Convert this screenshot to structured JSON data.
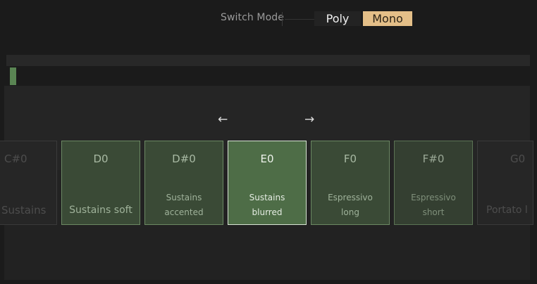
{
  "header": {
    "switch_mode_label": "Switch Mode",
    "options": [
      {
        "label": "Poly",
        "selected": false
      },
      {
        "label": "Mono",
        "selected": true
      }
    ]
  },
  "navigation": {
    "prev_arrow": "←",
    "next_arrow": "→"
  },
  "articulations": [
    {
      "note": "C#0",
      "desc": "Sustains",
      "state": "faint"
    },
    {
      "note": "D0",
      "desc": "Sustains soft",
      "state": "normal"
    },
    {
      "note": "D#0",
      "desc_line1": "Sustains",
      "desc_line2": "accented",
      "state": "normal"
    },
    {
      "note": "E0",
      "desc_line1": "Sustains",
      "desc_line2": "blurred",
      "state": "active"
    },
    {
      "note": "F0",
      "desc_line1": "Espressivo",
      "desc_line2": "long",
      "state": "normal"
    },
    {
      "note": "F#0",
      "desc_line1": "Espressivo",
      "desc_line2": "short",
      "state": "dim"
    },
    {
      "note": "G0",
      "desc": "Portato l",
      "state": "faint"
    }
  ],
  "colors": {
    "accent_mono": "#e4bf88",
    "card_green": "#3a4a36",
    "card_active": "#4e6d47",
    "marker_green": "#5a8553"
  }
}
